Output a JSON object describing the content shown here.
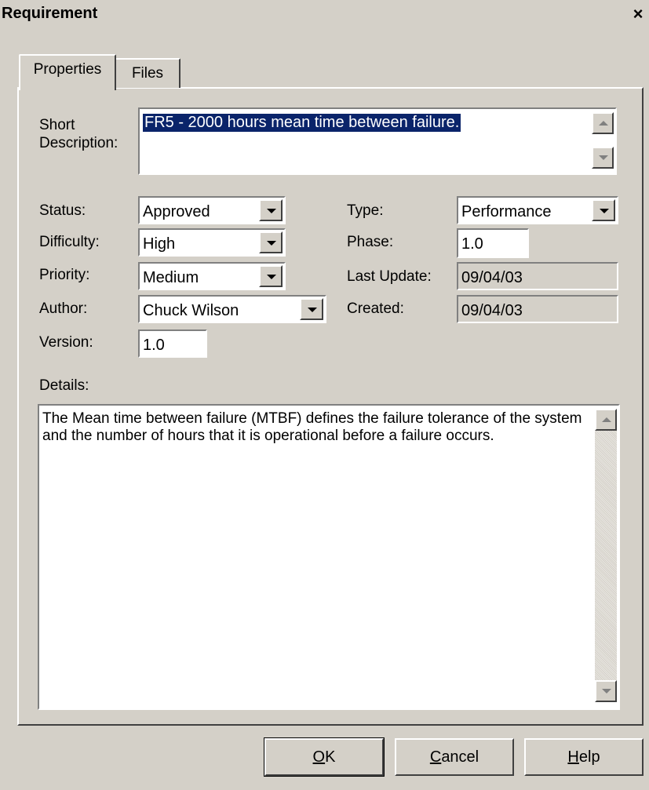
{
  "window": {
    "title": "Requirement",
    "close_glyph": "×"
  },
  "tabs": [
    {
      "label": "Properties",
      "active": true
    },
    {
      "label": "Files",
      "active": false
    }
  ],
  "fields": {
    "short_description": {
      "label_line1": "Short",
      "label_line2": "Description:",
      "value": "FR5 - 2000 hours mean time between failure."
    },
    "status": {
      "label": "Status:",
      "value": "Approved"
    },
    "difficulty": {
      "label": "Difficulty:",
      "value": "High"
    },
    "priority": {
      "label": "Priority:",
      "value": "Medium"
    },
    "author": {
      "label": "Author:",
      "value": "Chuck Wilson"
    },
    "version": {
      "label": "Version:",
      "value": "1.0"
    },
    "type": {
      "label": "Type:",
      "value": "Performance"
    },
    "phase": {
      "label": "Phase:",
      "value": "1.0"
    },
    "last_update": {
      "label": "Last Update:",
      "value": "09/04/03"
    },
    "created": {
      "label": "Created:",
      "value": "09/04/03"
    },
    "details": {
      "label": "Details:",
      "value": "The  Mean time between failure (MTBF) defines the failure tolerance of the system and the number of hours that it is operational before a failure occurs."
    }
  },
  "buttons": {
    "ok": {
      "mnemonic": "O",
      "rest": "K"
    },
    "cancel": {
      "mnemonic": "C",
      "rest": "ancel"
    },
    "help": {
      "mnemonic": "H",
      "rest": "elp"
    }
  }
}
